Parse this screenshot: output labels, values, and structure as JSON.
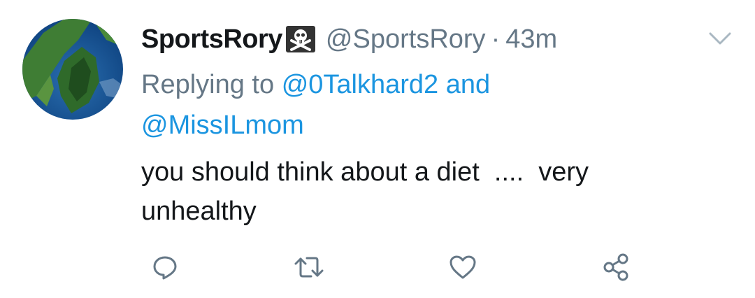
{
  "tweet": {
    "display_name": "SportsRory",
    "badge_emoji": "skull-crossbones",
    "handle": "@SportsRory",
    "separator": "·",
    "time": "43m",
    "replying_prefix": "Replying to",
    "replying_to_1": "@0Talkhard2",
    "replying_and": "and",
    "replying_to_2": "@MissILmom",
    "text": "you should think about a diet  ....  very\nunhealthy"
  },
  "actions": {
    "reply_icon": "comment-icon",
    "retweet_icon": "retweet-icon",
    "like_icon": "heart-icon",
    "share_icon": "share-icon"
  },
  "colors": {
    "text": "#14171a",
    "muted": "#657786",
    "link": "#1b95e0",
    "icon": "#657786"
  }
}
